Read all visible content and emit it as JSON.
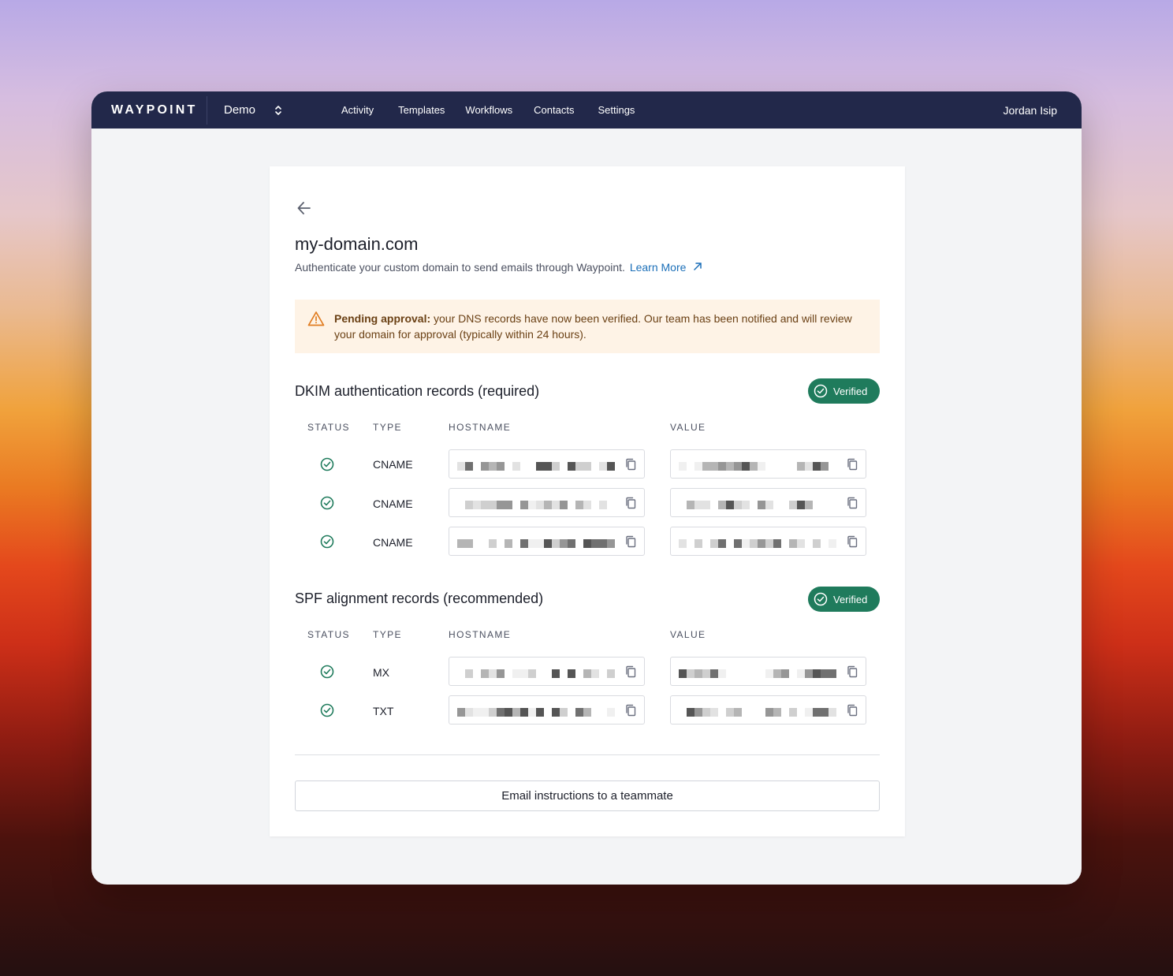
{
  "app": {
    "brand": "WAYPOINT",
    "workspace": "Demo",
    "nav": [
      "Activity",
      "Templates",
      "Workflows",
      "Contacts",
      "Settings"
    ],
    "user": "Jordan Isip"
  },
  "page": {
    "title": "my-domain.com",
    "subtitle": "Authenticate your custom domain to send emails through Waypoint.",
    "learn_more": "Learn More",
    "alert_bold": "Pending approval:",
    "alert_text": " your DNS records have now been verified. Our team has been notified and will review your domain for approval (typically within 24 hours)."
  },
  "columns": {
    "status": "STATUS",
    "type": "TYPE",
    "hostname": "HOSTNAME",
    "value": "VALUE"
  },
  "dkim": {
    "title": "DKIM authentication records (required)",
    "badge": "Verified",
    "rows": [
      {
        "type": "CNAME",
        "verified": true
      },
      {
        "type": "CNAME",
        "verified": true
      },
      {
        "type": "CNAME",
        "verified": true
      }
    ]
  },
  "spf": {
    "title": "SPF alignment records (recommended)",
    "badge": "Verified",
    "rows": [
      {
        "type": "MX",
        "verified": true
      },
      {
        "type": "TXT",
        "verified": true
      }
    ]
  },
  "actions": {
    "email_instructions": "Email instructions to a teammate"
  },
  "colors": {
    "nav_bg": "#22284a",
    "verified": "#1f7b5c",
    "link": "#1b6fb8",
    "alert_bg": "#fef3e6",
    "warning": "#e07b1f"
  },
  "icons": [
    "back-arrow-icon",
    "chevron-updown-icon",
    "external-link-icon",
    "warning-icon",
    "check-circle-icon",
    "copy-icon"
  ]
}
